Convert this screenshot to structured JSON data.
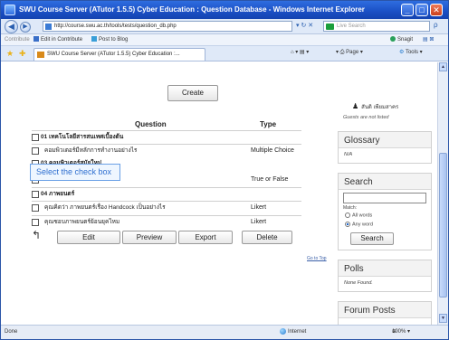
{
  "window": {
    "title": "SWU Course Server (ATutor 1.5.5) Cyber Education : Question Database - Windows Internet Explorer",
    "minimize": "_",
    "maximize": "□",
    "close": "✕"
  },
  "address_bar": {
    "back": "◀",
    "forward": "▶",
    "url": "http://course.swu.ac.th/tools/tests/question_db.php",
    "go_icons": "▾ ↻ ✕",
    "search_placeholder": "Live Search",
    "search_go": "ρ"
  },
  "links_bar": {
    "contribute": "Contribute",
    "edit_in_contribute": "Edit in Contribute",
    "post_to_blog": "Post to Blog",
    "snagit": "Snagit",
    "extra_icons": "▤ ⊠"
  },
  "tab_bar": {
    "tab_title": "SWU Course Server (ATutor 1.5.5) Cyber Education :...",
    "home_icons": "⌂ ▾ ▤ ▾",
    "print_label": "▾ ⎙ Page ▾",
    "tools_label": "Tools ▾"
  },
  "main": {
    "create_label": "Create",
    "col_question": "Question",
    "col_type": "Type",
    "rows": [
      {
        "kind": "cat",
        "question": "01 เทคโนโลยีสารสนเทศเบื้องต้น",
        "type": ""
      },
      {
        "kind": "item",
        "question": "คอมพิวเตอร์มีหลักการทำงานอย่างไร",
        "type": "Multiple Choice"
      },
      {
        "kind": "cat",
        "question": "03 คอมพิวเตอร์สมัยใหม่",
        "type": ""
      },
      {
        "kind": "item",
        "question": "...........................หรือไม่",
        "type": "True or False"
      },
      {
        "kind": "cat",
        "question": "04 ภาพยนตร์",
        "type": ""
      },
      {
        "kind": "item",
        "question": "คุณคิดว่า ภาพยนตร์เรื่อง Handcock เป็นอย่างไร",
        "type": "Likert"
      },
      {
        "kind": "item",
        "question": "คุณชอบภาพยนตร์ย้อนยุคไหม",
        "type": "Likert"
      }
    ],
    "tooltip": "Select the check box",
    "actions": {
      "edit": "Edit",
      "preview": "Preview",
      "export": "Export",
      "delete": "Delete"
    },
    "goto_top": "Go to Top"
  },
  "sidebar": {
    "user_name": "สันติ เพียมสาคร",
    "guests_text": "Guests are not listed",
    "glossary_title": "Glossary",
    "glossary_text": "N/A",
    "search_title": "Search",
    "match_label": "Match:",
    "all_words": "All words",
    "any_word": "Any word",
    "search_button": "Search",
    "polls_title": "Polls",
    "polls_text": "None Found.",
    "forum_title": "Forum Posts"
  },
  "status_bar": {
    "left": "Done",
    "zone": "Internet",
    "zoom": "100%",
    "zoom_arrow": "▾"
  }
}
